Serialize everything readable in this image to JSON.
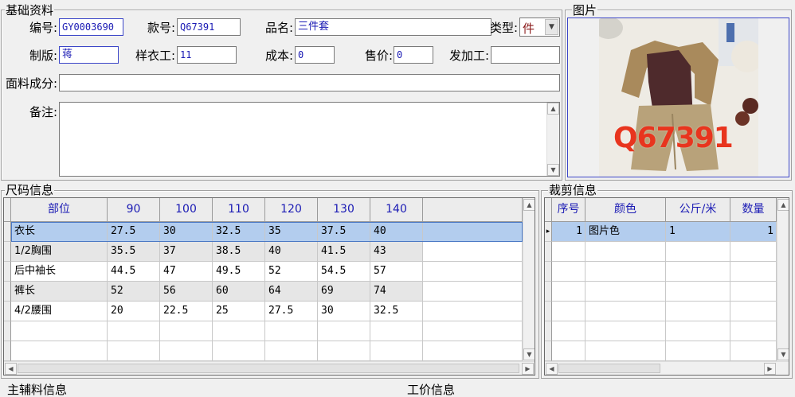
{
  "basic": {
    "title": "基础资料",
    "code_label": "编号:",
    "code_value": "GY0003690",
    "style_label": "款号:",
    "style_value": "Q67391",
    "name_label": "品名:",
    "name_value": "三件套",
    "type_label": "类型:",
    "type_value": "件",
    "maker_label": "制版:",
    "maker_value": "蒋",
    "sample_label": "样衣工:",
    "sample_value": "11",
    "cost_label": "成本:",
    "cost_value": "0",
    "price_label": "售价:",
    "price_value": "0",
    "process_label": "发加工:",
    "process_value": "",
    "fabric_label": "面料成分:",
    "fabric_value": "",
    "remark_label": "备注:",
    "remark_value": ""
  },
  "picture": {
    "title": "图片",
    "overlay_text": "Q67391"
  },
  "size_info": {
    "title": "尺码信息",
    "columns": [
      "部位",
      "90",
      "100",
      "110",
      "120",
      "130",
      "140"
    ],
    "rows": [
      [
        "衣长",
        "27.5",
        "30",
        "32.5",
        "35",
        "37.5",
        "40"
      ],
      [
        "1/2胸围",
        "35.5",
        "37",
        "38.5",
        "40",
        "41.5",
        "43"
      ],
      [
        "后中袖长",
        "44.5",
        "47",
        "49.5",
        "52",
        "54.5",
        "57"
      ],
      [
        "裤长",
        "52",
        "56",
        "60",
        "64",
        "69",
        "74"
      ],
      [
        "4/2腰围",
        "20",
        "22.5",
        "25",
        "27.5",
        "30",
        "32.5"
      ]
    ]
  },
  "cut_info": {
    "title": "裁剪信息",
    "columns": [
      "序号",
      "颜色",
      "公斤/米",
      "数量"
    ],
    "rows": [
      [
        "1",
        "图片色",
        "1",
        "1"
      ]
    ]
  },
  "bottom": {
    "accessory_title": "主辅料信息",
    "labor_title": "工价信息"
  },
  "colors": {
    "header_text": "#1a1ab4",
    "selected_row": "#b3cdee",
    "alt_row": "#e6e6e6",
    "overlay": "#e8351e"
  }
}
